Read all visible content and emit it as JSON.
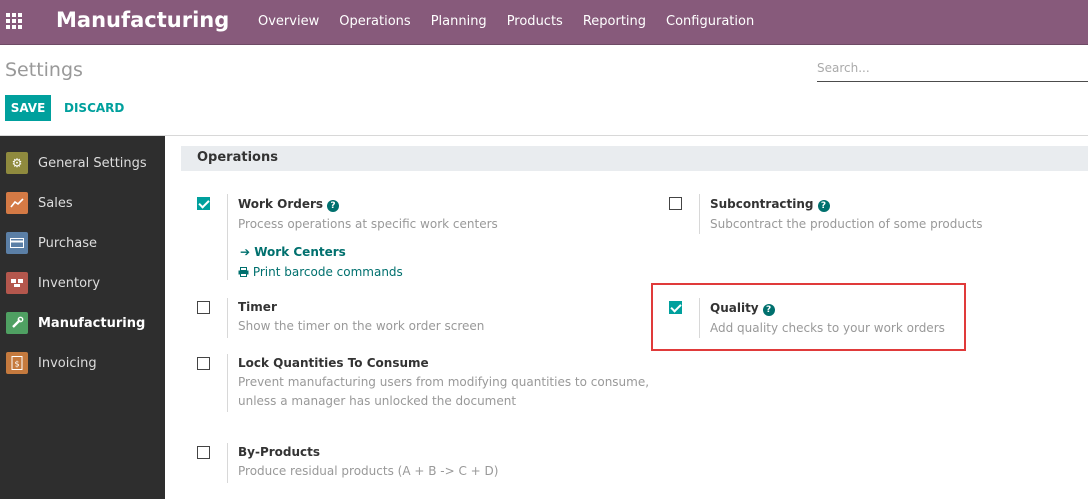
{
  "navbar": {
    "app_name": "Manufacturing",
    "menu": [
      "Overview",
      "Operations",
      "Planning",
      "Products",
      "Reporting",
      "Configuration"
    ]
  },
  "control_panel": {
    "breadcrumb": "Settings",
    "search_placeholder": "Search...",
    "save_label": "SAVE",
    "discard_label": "DISCARD"
  },
  "sidebar": {
    "items": [
      {
        "label": "General Settings",
        "icon": "gear-icon",
        "color": "#8f8a3e",
        "active": false
      },
      {
        "label": "Sales",
        "icon": "chart-icon",
        "color": "#d47a45",
        "active": false
      },
      {
        "label": "Purchase",
        "icon": "card-icon",
        "color": "#5b7fa6",
        "active": false
      },
      {
        "label": "Inventory",
        "icon": "boxes-icon",
        "color": "#b4574d",
        "active": false
      },
      {
        "label": "Manufacturing",
        "icon": "wrench-icon",
        "color": "#4fa062",
        "active": true
      },
      {
        "label": "Invoicing",
        "icon": "invoice-icon",
        "color": "#c57a3e",
        "active": false
      }
    ]
  },
  "section": {
    "title": "Operations"
  },
  "settings": {
    "work_orders": {
      "title": "Work Orders",
      "checked": true,
      "desc": "Process operations at specific work centers",
      "link1": "Work Centers",
      "link2": "Print barcode commands"
    },
    "subcontracting": {
      "title": "Subcontracting",
      "checked": false,
      "desc": "Subcontract the production of some products"
    },
    "timer": {
      "title": "Timer",
      "checked": false,
      "desc": "Show the timer on the work order screen"
    },
    "quality": {
      "title": "Quality",
      "checked": true,
      "desc": "Add quality checks to your work orders"
    },
    "lock_quantities": {
      "title": "Lock Quantities To Consume",
      "checked": false,
      "desc_line1": "Prevent manufacturing users from modifying quantities to consume,",
      "desc_line2": "unless a manager has unlocked the document"
    },
    "by_products": {
      "title": "By-Products",
      "checked": false,
      "desc": "Produce residual products (A + B -> C + D)"
    }
  },
  "colors": {
    "navbar": "#875a7b",
    "accent": "#00a09d",
    "link": "#00706e",
    "highlight": "#e03a3a",
    "sidebar": "#2e2e2e"
  }
}
